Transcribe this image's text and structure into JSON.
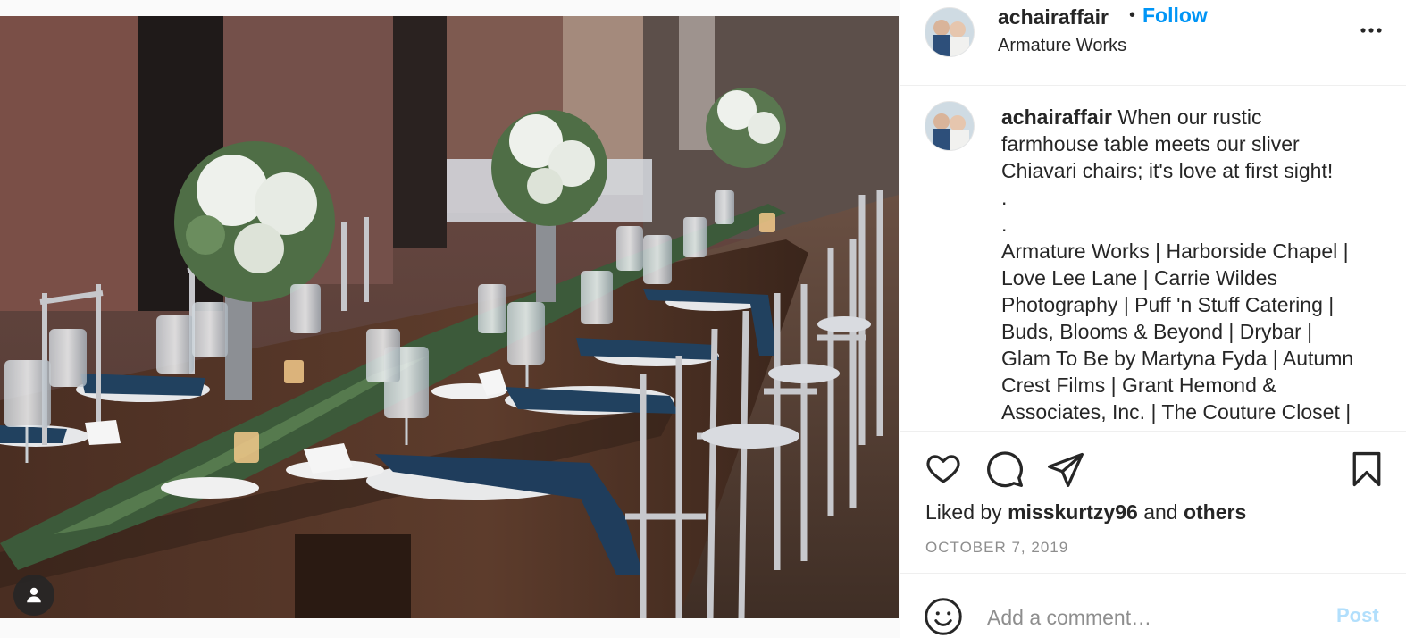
{
  "post": {
    "username": "achairaffair",
    "separator": "•",
    "follow_label": "Follow",
    "location": "Armature Works",
    "caption_lines": [
      "When our rustic",
      "farmhouse table meets our sliver",
      "Chiavari chairs; it's love at first sight!",
      ".",
      ".",
      "Armature Works | Harborside Chapel |",
      "Love Lee Lane | Carrie Wildes",
      "Photography | Puff 'n Stuff Catering |",
      "Buds, Blooms & Beyond | Drybar |",
      "Glam To Be by Martyna Fyda | Autumn",
      "Crest Films | Grant Hemond &",
      "Associates, Inc. | The Couture Closet |"
    ],
    "likes_prefix": "Liked by ",
    "likes_user": "misskurtzy96",
    "likes_and": " and ",
    "likes_others": "others",
    "date": "OCTOBER 7, 2019"
  },
  "comment": {
    "placeholder": "Add a comment…",
    "post_label": "Post"
  },
  "icons": {
    "more": "more-options-icon",
    "like": "heart-icon",
    "comment": "comment-icon",
    "share": "paper-plane-icon",
    "save": "bookmark-icon",
    "emoji": "smiley-icon",
    "user_tag": "user-icon"
  },
  "colors": {
    "follow_blue": "#0095f6",
    "post_disabled": "#b2dffc",
    "meta_gray": "#8e8e8e",
    "text": "#262626"
  }
}
